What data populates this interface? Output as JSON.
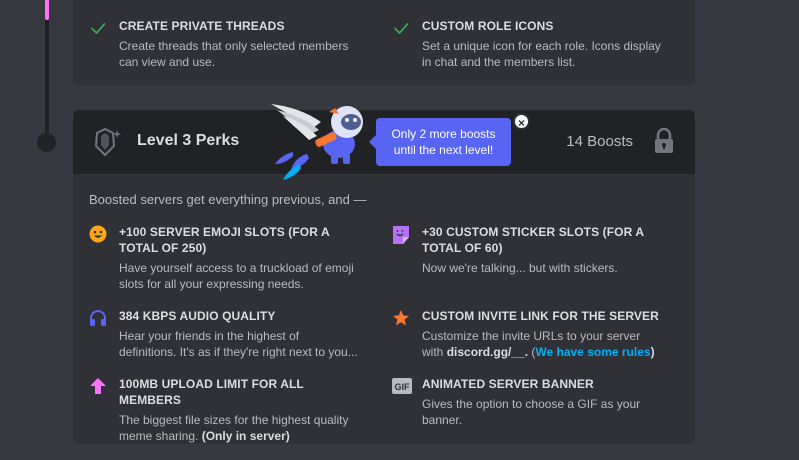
{
  "top_perks": [
    {
      "title": "CREATE PRIVATE THREADS",
      "desc": "Create threads that only selected members can view and use.",
      "icon": "checkmark-icon"
    },
    {
      "title": "CUSTOM ROLE ICONS",
      "desc": "Set a unique icon for each role. Icons display in chat and the members list.",
      "icon": "checkmark-icon"
    }
  ],
  "level": {
    "title": "Level 3 Perks",
    "boosts": "14 Boosts",
    "tooltip": "Only 2 more boosts until the next level!",
    "close": "×",
    "intro": "Boosted servers get everything previous, and —"
  },
  "perks": [
    {
      "title": "+100 SERVER EMOJI SLOTS (FOR A TOTAL OF 250)",
      "desc": "Have yourself access to a truckload of emoji slots for all your expressing needs.",
      "icon": "emoji-icon"
    },
    {
      "title": "+30 CUSTOM STICKER SLOTS (FOR A TOTAL OF 60)",
      "desc": "Now we're talking... but with stickers.",
      "icon": "sticker-icon"
    },
    {
      "title": "384 KBPS AUDIO QUALITY",
      "desc": "Hear your friends in the highest of definitions. It's as if they're right next to you...",
      "icon": "headphones-icon"
    },
    {
      "title": "CUSTOM INVITE LINK FOR THE SERVER",
      "desc_prefix": "Customize the invite URLs to your server with",
      "desc_bold": "discord.gg/__.",
      "desc_link": "We have some rules",
      "icon": "star-icon"
    },
    {
      "title": "100MB UPLOAD LIMIT FOR ALL MEMBERS",
      "desc": "The biggest file sizes for the highest quality meme sharing.",
      "desc_bold": "(Only in server)",
      "icon": "upload-arrow-icon"
    },
    {
      "title": "ANIMATED SERVER BANNER",
      "desc": "Gives the option to choose a GIF as your banner.",
      "icon": "gif-icon",
      "icon_text": "GIF"
    }
  ],
  "colors": {
    "check": "#3ba55c",
    "emoji": "#faa61a",
    "sticker": "#b473f5",
    "headphones": "#5865f2",
    "star": "#f57731",
    "upload": "#ff73fa",
    "gif": "#b5bac1",
    "tooltip": "#5865f2",
    "link": "#00aff4"
  }
}
